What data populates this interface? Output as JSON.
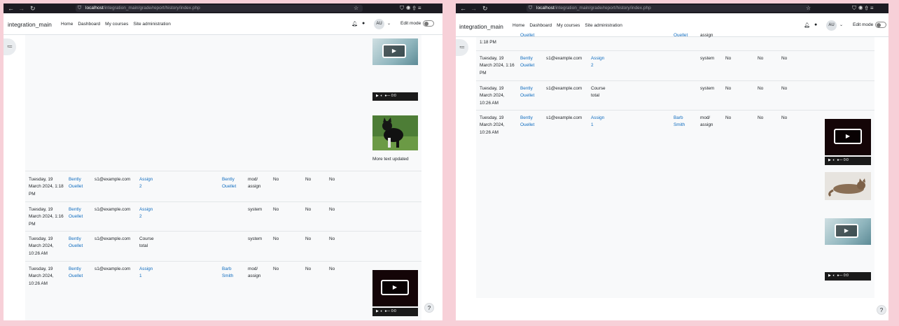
{
  "browser": {
    "url_host": "localhost",
    "url_path": "/integration_main/grade/report/history/index.php"
  },
  "nav": {
    "brand": "integration_main",
    "menu": [
      "Home",
      "Dashboard",
      "My courses",
      "Site administration"
    ],
    "avatar": "AU",
    "edit_mode": "Edit mode"
  },
  "icons": {
    "back": "arrow-left-icon",
    "forward": "arrow-right-icon",
    "reload": "reload-icon",
    "drawer": "index-drawer-icon",
    "help": "help-icon",
    "bell": "bell-icon",
    "chat": "chat-icon"
  },
  "left": {
    "caption": "More text updated",
    "rows": [
      {
        "date": "Tuesday, 19 March 2024, 1:18 PM",
        "name": "Bently Ouellet",
        "email": "s1@example.com",
        "item": "Assign 2",
        "grader": "Bently Ouellet",
        "source": "mod/ assign",
        "f1": "No",
        "f2": "No",
        "f3": "No"
      },
      {
        "date": "Tuesday, 19 March 2024, 1:16 PM",
        "name": "Bently Ouellet",
        "email": "s1@example.com",
        "item": "Assign 2",
        "grader": "",
        "source": "system",
        "f1": "No",
        "f2": "No",
        "f3": "No"
      },
      {
        "date": "Tuesday, 19 March 2024, 10:26 AM",
        "name": "Bently Ouellet",
        "email": "s1@example.com",
        "item": "Course total",
        "grader": "",
        "source": "system",
        "f1": "No",
        "f2": "No",
        "f3": "No"
      },
      {
        "date": "Tuesday, 19 March 2024, 10:26 AM",
        "name": "Bently Ouellet",
        "email": "s1@example.com",
        "item": "Assign 1",
        "grader": "Barb Smith",
        "source": "mod/ assign",
        "f1": "No",
        "f2": "No",
        "f3": "No"
      }
    ]
  },
  "right": {
    "top_partial": {
      "date": "1:18 PM",
      "name": "Ouellet",
      "item": "",
      "grader": "Ouellet",
      "source": "assign"
    },
    "rows": [
      {
        "date": "Tuesday, 19 March 2024, 1:16 PM",
        "name": "Bently Ouellet",
        "email": "s1@example.com",
        "item": "Assign 2",
        "grader": "",
        "source": "system",
        "f1": "No",
        "f2": "No",
        "f3": "No"
      },
      {
        "date": "Tuesday, 19 March 2024, 10:26 AM",
        "name": "Bently Ouellet",
        "email": "s1@example.com",
        "item": "Course total",
        "grader": "",
        "source": "system",
        "f1": "No",
        "f2": "No",
        "f3": "No"
      },
      {
        "date": "Tuesday, 19 March 2024, 10:26 AM",
        "name": "Bently Ouellet",
        "email": "s1@example.com",
        "item": "Assign 1",
        "grader": "Barb Smith",
        "source": "mod/ assign",
        "f1": "No",
        "f2": "No",
        "f3": "No"
      }
    ]
  },
  "video": {
    "time_label": "0:0"
  },
  "help_label": "?",
  "colors": {
    "link": "#0f6cbf",
    "background": "#f7d0d8",
    "browser_chrome": "#1c1b22"
  }
}
